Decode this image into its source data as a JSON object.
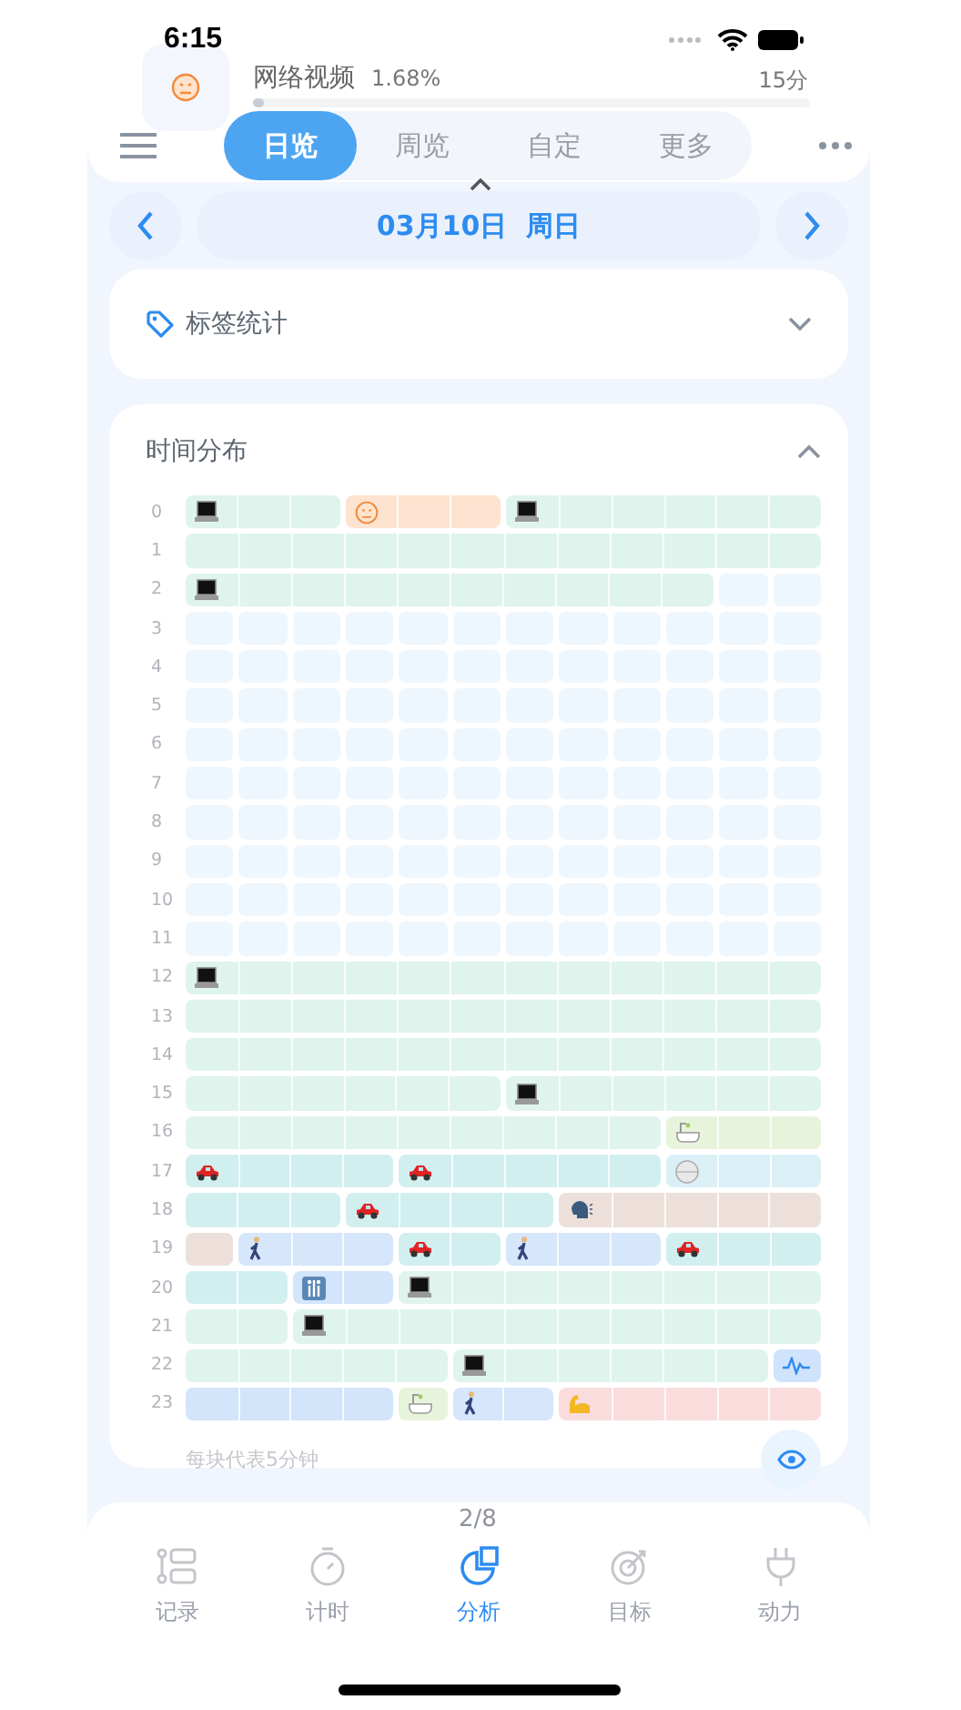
{
  "status_bar": {
    "time": "6:15"
  },
  "background_card": {
    "title": "网络视频",
    "percent": "1.68%",
    "duration": "15分",
    "level": 0.02
  },
  "tabs": [
    {
      "label": "日览",
      "selected": true
    },
    {
      "label": "周览",
      "selected": false
    },
    {
      "label": "自定",
      "selected": false
    },
    {
      "label": "更多",
      "selected": false
    }
  ],
  "date": "03月10日  周日",
  "tag_stats": {
    "title": "标签统计",
    "expanded": false
  },
  "time_distribution": {
    "title": "时间分布",
    "expanded": true,
    "footnote": "每块代表5分钟",
    "rows": [
      {
        "label": "0",
        "blocks": [
          {
            "kind": "laptop",
            "color": "#dff4ec"
          },
          {
            "kind": "cont"
          },
          {
            "kind": "cont"
          },
          {
            "kind": "face",
            "color": "#fde3d0"
          },
          {
            "kind": "cont"
          },
          {
            "kind": "cont"
          },
          {
            "kind": "laptop",
            "color": "#dff4ec"
          },
          {
            "kind": "cont"
          },
          {
            "kind": "cont"
          },
          {
            "kind": "cont"
          },
          {
            "kind": "cont"
          },
          {
            "kind": "cont"
          }
        ]
      },
      {
        "label": "1",
        "blocks": [
          {
            "kind": "plain",
            "color": "#dff4ec"
          },
          {
            "kind": "cont"
          },
          {
            "kind": "cont"
          },
          {
            "kind": "cont"
          },
          {
            "kind": "cont"
          },
          {
            "kind": "cont"
          },
          {
            "kind": "cont"
          },
          {
            "kind": "cont"
          },
          {
            "kind": "cont"
          },
          {
            "kind": "cont"
          },
          {
            "kind": "cont"
          },
          {
            "kind": "cont"
          }
        ]
      },
      {
        "label": "2",
        "blocks": [
          {
            "kind": "laptop",
            "color": "#dff4ec"
          },
          {
            "kind": "cont"
          },
          {
            "kind": "cont"
          },
          {
            "kind": "cont"
          },
          {
            "kind": "cont"
          },
          {
            "kind": "cont"
          },
          {
            "kind": "cont"
          },
          {
            "kind": "cont"
          },
          {
            "kind": "cont"
          },
          {
            "kind": "cont"
          },
          {
            "kind": "empty"
          },
          {
            "kind": "empty"
          }
        ]
      },
      {
        "label": "3",
        "blocks": [
          {
            "kind": "empty"
          },
          {
            "kind": "empty"
          },
          {
            "kind": "empty"
          },
          {
            "kind": "empty"
          },
          {
            "kind": "empty"
          },
          {
            "kind": "empty"
          },
          {
            "kind": "empty"
          },
          {
            "kind": "empty"
          },
          {
            "kind": "empty"
          },
          {
            "kind": "empty"
          },
          {
            "kind": "empty"
          },
          {
            "kind": "empty"
          }
        ]
      },
      {
        "label": "4",
        "blocks": [
          {
            "kind": "empty"
          },
          {
            "kind": "empty"
          },
          {
            "kind": "empty"
          },
          {
            "kind": "empty"
          },
          {
            "kind": "empty"
          },
          {
            "kind": "empty"
          },
          {
            "kind": "empty"
          },
          {
            "kind": "empty"
          },
          {
            "kind": "empty"
          },
          {
            "kind": "empty"
          },
          {
            "kind": "empty"
          },
          {
            "kind": "empty"
          }
        ]
      },
      {
        "label": "5",
        "blocks": [
          {
            "kind": "empty"
          },
          {
            "kind": "empty"
          },
          {
            "kind": "empty"
          },
          {
            "kind": "empty"
          },
          {
            "kind": "empty"
          },
          {
            "kind": "empty"
          },
          {
            "kind": "empty"
          },
          {
            "kind": "empty"
          },
          {
            "kind": "empty"
          },
          {
            "kind": "empty"
          },
          {
            "kind": "empty"
          },
          {
            "kind": "empty"
          }
        ]
      },
      {
        "label": "6",
        "blocks": [
          {
            "kind": "empty"
          },
          {
            "kind": "empty"
          },
          {
            "kind": "empty"
          },
          {
            "kind": "empty"
          },
          {
            "kind": "empty"
          },
          {
            "kind": "empty"
          },
          {
            "kind": "empty"
          },
          {
            "kind": "empty"
          },
          {
            "kind": "empty"
          },
          {
            "kind": "empty"
          },
          {
            "kind": "empty"
          },
          {
            "kind": "empty"
          }
        ]
      },
      {
        "label": "7",
        "blocks": [
          {
            "kind": "empty"
          },
          {
            "kind": "empty"
          },
          {
            "kind": "empty"
          },
          {
            "kind": "empty"
          },
          {
            "kind": "empty"
          },
          {
            "kind": "empty"
          },
          {
            "kind": "empty"
          },
          {
            "kind": "empty"
          },
          {
            "kind": "empty"
          },
          {
            "kind": "empty"
          },
          {
            "kind": "empty"
          },
          {
            "kind": "empty"
          }
        ]
      },
      {
        "label": "8",
        "blocks": [
          {
            "kind": "empty"
          },
          {
            "kind": "empty"
          },
          {
            "kind": "empty"
          },
          {
            "kind": "empty"
          },
          {
            "kind": "empty"
          },
          {
            "kind": "empty"
          },
          {
            "kind": "empty"
          },
          {
            "kind": "empty"
          },
          {
            "kind": "empty"
          },
          {
            "kind": "empty"
          },
          {
            "kind": "empty"
          },
          {
            "kind": "empty"
          }
        ]
      },
      {
        "label": "9",
        "blocks": [
          {
            "kind": "empty"
          },
          {
            "kind": "empty"
          },
          {
            "kind": "empty"
          },
          {
            "kind": "empty"
          },
          {
            "kind": "empty"
          },
          {
            "kind": "empty"
          },
          {
            "kind": "empty"
          },
          {
            "kind": "empty"
          },
          {
            "kind": "empty"
          },
          {
            "kind": "empty"
          },
          {
            "kind": "empty"
          },
          {
            "kind": "empty"
          }
        ]
      },
      {
        "label": "10",
        "blocks": [
          {
            "kind": "empty"
          },
          {
            "kind": "empty"
          },
          {
            "kind": "empty"
          },
          {
            "kind": "empty"
          },
          {
            "kind": "empty"
          },
          {
            "kind": "empty"
          },
          {
            "kind": "empty"
          },
          {
            "kind": "empty"
          },
          {
            "kind": "empty"
          },
          {
            "kind": "empty"
          },
          {
            "kind": "empty"
          },
          {
            "kind": "empty"
          }
        ]
      },
      {
        "label": "11",
        "blocks": [
          {
            "kind": "empty"
          },
          {
            "kind": "empty"
          },
          {
            "kind": "empty"
          },
          {
            "kind": "empty"
          },
          {
            "kind": "empty"
          },
          {
            "kind": "empty"
          },
          {
            "kind": "empty"
          },
          {
            "kind": "empty"
          },
          {
            "kind": "empty"
          },
          {
            "kind": "empty"
          },
          {
            "kind": "empty"
          },
          {
            "kind": "empty"
          }
        ]
      },
      {
        "label": "12",
        "blocks": [
          {
            "kind": "laptop",
            "color": "#dff4ec"
          },
          {
            "kind": "cont"
          },
          {
            "kind": "cont"
          },
          {
            "kind": "cont"
          },
          {
            "kind": "cont"
          },
          {
            "kind": "cont"
          },
          {
            "kind": "cont"
          },
          {
            "kind": "cont"
          },
          {
            "kind": "cont"
          },
          {
            "kind": "cont"
          },
          {
            "kind": "cont"
          },
          {
            "kind": "cont"
          }
        ]
      },
      {
        "label": "13",
        "blocks": [
          {
            "kind": "plain",
            "color": "#dff4ec"
          },
          {
            "kind": "cont"
          },
          {
            "kind": "cont"
          },
          {
            "kind": "cont"
          },
          {
            "kind": "cont"
          },
          {
            "kind": "cont"
          },
          {
            "kind": "cont"
          },
          {
            "kind": "cont"
          },
          {
            "kind": "cont"
          },
          {
            "kind": "cont"
          },
          {
            "kind": "cont"
          },
          {
            "kind": "cont"
          }
        ]
      },
      {
        "label": "14",
        "blocks": [
          {
            "kind": "plain",
            "color": "#dff4ec"
          },
          {
            "kind": "cont"
          },
          {
            "kind": "cont"
          },
          {
            "kind": "cont"
          },
          {
            "kind": "cont"
          },
          {
            "kind": "cont"
          },
          {
            "kind": "cont"
          },
          {
            "kind": "cont"
          },
          {
            "kind": "cont"
          },
          {
            "kind": "cont"
          },
          {
            "kind": "cont"
          },
          {
            "kind": "cont"
          }
        ]
      },
      {
        "label": "15",
        "blocks": [
          {
            "kind": "plain",
            "color": "#dff4ec"
          },
          {
            "kind": "cont"
          },
          {
            "kind": "cont"
          },
          {
            "kind": "cont"
          },
          {
            "kind": "cont"
          },
          {
            "kind": "cont"
          },
          {
            "kind": "laptop",
            "color": "#dff4ec"
          },
          {
            "kind": "cont"
          },
          {
            "kind": "cont"
          },
          {
            "kind": "cont"
          },
          {
            "kind": "cont"
          },
          {
            "kind": "cont"
          }
        ]
      },
      {
        "label": "16",
        "blocks": [
          {
            "kind": "plain",
            "color": "#dff4ec"
          },
          {
            "kind": "cont"
          },
          {
            "kind": "cont"
          },
          {
            "kind": "cont"
          },
          {
            "kind": "cont"
          },
          {
            "kind": "cont"
          },
          {
            "kind": "cont"
          },
          {
            "kind": "cont"
          },
          {
            "kind": "cont"
          },
          {
            "kind": "bath",
            "color": "#e8f3dc"
          },
          {
            "kind": "cont"
          },
          {
            "kind": "cont"
          }
        ]
      },
      {
        "label": "17",
        "blocks": [
          {
            "kind": "car",
            "color": "#d2eff0"
          },
          {
            "kind": "cont"
          },
          {
            "kind": "cont"
          },
          {
            "kind": "cont"
          },
          {
            "kind": "car",
            "color": "#d2eff0"
          },
          {
            "kind": "cont"
          },
          {
            "kind": "cont"
          },
          {
            "kind": "cont"
          },
          {
            "kind": "cont"
          },
          {
            "kind": "ball",
            "color": "#daf0f6"
          },
          {
            "kind": "cont"
          },
          {
            "kind": "cont"
          }
        ]
      },
      {
        "label": "18",
        "blocks": [
          {
            "kind": "plain",
            "color": "#d2eff0"
          },
          {
            "kind": "cont"
          },
          {
            "kind": "cont"
          },
          {
            "kind": "car",
            "color": "#d2eff0"
          },
          {
            "kind": "cont"
          },
          {
            "kind": "cont"
          },
          {
            "kind": "cont"
          },
          {
            "kind": "head",
            "color": "#ede0da"
          },
          {
            "kind": "cont"
          },
          {
            "kind": "cont"
          },
          {
            "kind": "cont"
          },
          {
            "kind": "cont"
          }
        ]
      },
      {
        "label": "19",
        "blocks": [
          {
            "kind": "plain",
            "color": "#ede0da"
          },
          {
            "kind": "walker",
            "color": "#d6e6fb"
          },
          {
            "kind": "cont"
          },
          {
            "kind": "cont"
          },
          {
            "kind": "car",
            "color": "#d2eff0"
          },
          {
            "kind": "cont"
          },
          {
            "kind": "walker",
            "color": "#d6e6fb"
          },
          {
            "kind": "cont"
          },
          {
            "kind": "cont"
          },
          {
            "kind": "car",
            "color": "#d2eff0"
          },
          {
            "kind": "cont"
          },
          {
            "kind": "cont"
          }
        ]
      },
      {
        "label": "20",
        "blocks": [
          {
            "kind": "plain",
            "color": "#d2eff0"
          },
          {
            "kind": "cont"
          },
          {
            "kind": "restroom",
            "color": "#d2e5fb"
          },
          {
            "kind": "cont"
          },
          {
            "kind": "laptop",
            "color": "#dff4ec"
          },
          {
            "kind": "cont"
          },
          {
            "kind": "cont"
          },
          {
            "kind": "cont"
          },
          {
            "kind": "cont"
          },
          {
            "kind": "cont"
          },
          {
            "kind": "cont"
          },
          {
            "kind": "cont"
          }
        ]
      },
      {
        "label": "21",
        "blocks": [
          {
            "kind": "plain",
            "color": "#dff4ec"
          },
          {
            "kind": "cont"
          },
          {
            "kind": "laptop",
            "color": "#dff4ec"
          },
          {
            "kind": "cont"
          },
          {
            "kind": "cont"
          },
          {
            "kind": "cont"
          },
          {
            "kind": "cont"
          },
          {
            "kind": "cont"
          },
          {
            "kind": "cont"
          },
          {
            "kind": "cont"
          },
          {
            "kind": "cont"
          },
          {
            "kind": "cont"
          }
        ]
      },
      {
        "label": "22",
        "blocks": [
          {
            "kind": "plain",
            "color": "#dff4ec"
          },
          {
            "kind": "cont"
          },
          {
            "kind": "cont"
          },
          {
            "kind": "cont"
          },
          {
            "kind": "cont"
          },
          {
            "kind": "laptop",
            "color": "#dff4ec"
          },
          {
            "kind": "cont"
          },
          {
            "kind": "cont"
          },
          {
            "kind": "cont"
          },
          {
            "kind": "cont"
          },
          {
            "kind": "cont"
          },
          {
            "kind": "pulse",
            "color": "#cfe4fc"
          }
        ]
      },
      {
        "label": "23",
        "blocks": [
          {
            "kind": "plain",
            "color": "#d2e5fb"
          },
          {
            "kind": "cont"
          },
          {
            "kind": "cont"
          },
          {
            "kind": "cont"
          },
          {
            "kind": "bath",
            "color": "#e8f3dc"
          },
          {
            "kind": "walker",
            "color": "#d6e6fb"
          },
          {
            "kind": "cont"
          },
          {
            "kind": "arm",
            "color": "#fbdcdc"
          },
          {
            "kind": "cont"
          },
          {
            "kind": "cont"
          },
          {
            "kind": "cont"
          },
          {
            "kind": "cont"
          }
        ]
      }
    ]
  },
  "page_indicator": "2/8",
  "nav": [
    {
      "label": "记录",
      "kind": "list",
      "selected": false
    },
    {
      "label": "计时",
      "kind": "timer",
      "selected": false
    },
    {
      "label": "分析",
      "kind": "pie",
      "selected": true
    },
    {
      "label": "目标",
      "kind": "target",
      "selected": false
    },
    {
      "label": "动力",
      "kind": "plug",
      "selected": false
    }
  ]
}
